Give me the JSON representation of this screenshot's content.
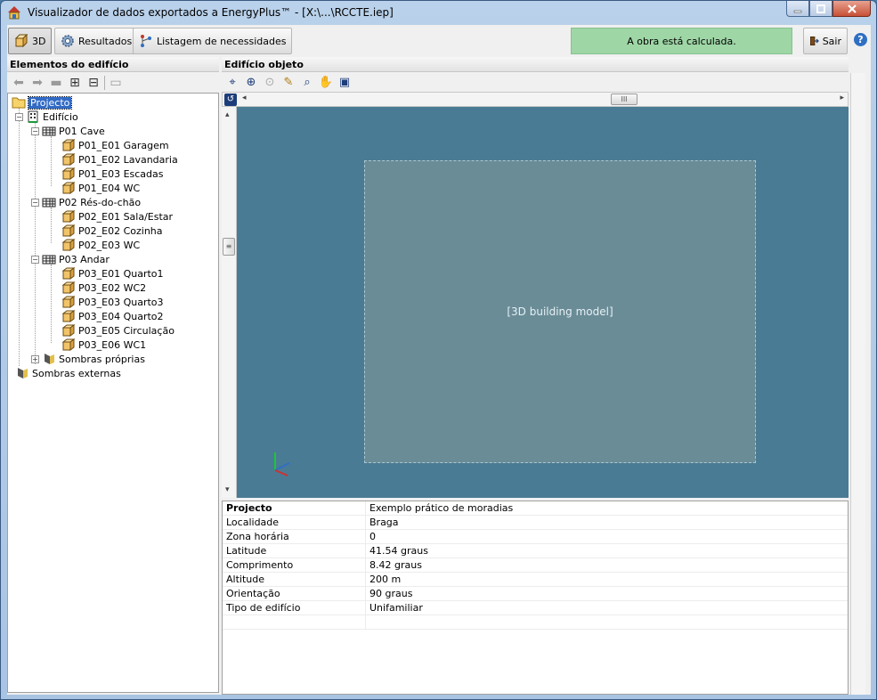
{
  "window": {
    "title": "Visualizador de dados exportados a EnergyPlus™ - [X:\\...\\RCCTE.iep]"
  },
  "toolbar": {
    "btn_3d": "3D",
    "btn_results": "Resultados",
    "btn_needs": "Listagem de necessidades",
    "status": "A obra está calculada.",
    "btn_exit": "Sair",
    "help": "?"
  },
  "left_panel": {
    "header": "Elementos do edifício"
  },
  "tree": {
    "root": "Projecto",
    "building": "Edifício",
    "floors": [
      {
        "label": "P01 Cave",
        "rooms": [
          "P01_E01 Garagem",
          "P01_E02 Lavandaria",
          "P01_E03 Escadas",
          "P01_E04 WC"
        ]
      },
      {
        "label": "P02 Rés-do-chão",
        "rooms": [
          "P02_E01 Sala/Estar",
          "P02_E02 Cozinha",
          "P02_E03 WC"
        ]
      },
      {
        "label": "P03 Andar",
        "rooms": [
          "P03_E01 Quarto1",
          "P03_E02 WC2",
          "P03_E03 Quarto3",
          "P03_E04 Quarto2",
          "P03_E05 Circulação",
          "P03_E06 WC1"
        ]
      }
    ],
    "own_shadows": "Sombras próprias",
    "external_shadows": "Sombras externas"
  },
  "right_panel": {
    "header": "Edifício objeto"
  },
  "properties": {
    "rows": [
      {
        "key": "Projecto",
        "value": "Exemplo prático de moradias"
      },
      {
        "key": "Localidade",
        "value": "Braga"
      },
      {
        "key": "Zona horária",
        "value": "0"
      },
      {
        "key": "Latitude",
        "value": "41.54 graus"
      },
      {
        "key": "Comprimento",
        "value": "8.42 graus"
      },
      {
        "key": "Altitude",
        "value": "200 m"
      },
      {
        "key": "Orientação",
        "value": "90 graus"
      },
      {
        "key": "Tipo de edifício",
        "value": "Unifamiliar"
      }
    ]
  },
  "colors": {
    "status_bg": "#9ed6a6",
    "viewport_bg": "#4a7b94",
    "selection": "#316ac5"
  }
}
